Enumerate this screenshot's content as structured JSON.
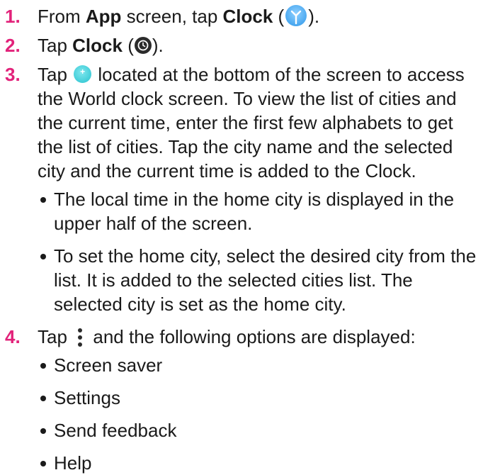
{
  "accent_color": "#e2227a",
  "steps": [
    {
      "number": "1.",
      "text_a": "From ",
      "bold_a": "App",
      "text_b": " screen, tap ",
      "bold_b": "Clock",
      "text_c": " (",
      "icon": "clock-app-icon",
      "text_d": ")."
    },
    {
      "number": "2.",
      "text_a": "Tap ",
      "bold_a": "Clock",
      "text_b": " (",
      "icon": "clock-tab-icon",
      "text_c": ")."
    },
    {
      "number": "3.",
      "text_a": "Tap ",
      "icon": "add-city-plus-icon",
      "text_b": " located at the bottom of the screen to access the World clock screen. To view the list of cities and the current time, enter the first few alphabets to get the list of cities. Tap the city name and the selected city and the current time is added to the Clock.",
      "bullets": [
        "The local time in the home city is displayed in the upper half of the screen.",
        "To set the home city, select the desired city from the list. It is added to the selected cities list. The selected city is set as the home city."
      ]
    },
    {
      "number": "4.",
      "text_a": "Tap ",
      "icon": "more-options-icon",
      "text_b": " and the following options are displayed:",
      "bullets": [
        "Screen saver",
        "Settings",
        "Send feedback",
        "Help"
      ]
    }
  ]
}
